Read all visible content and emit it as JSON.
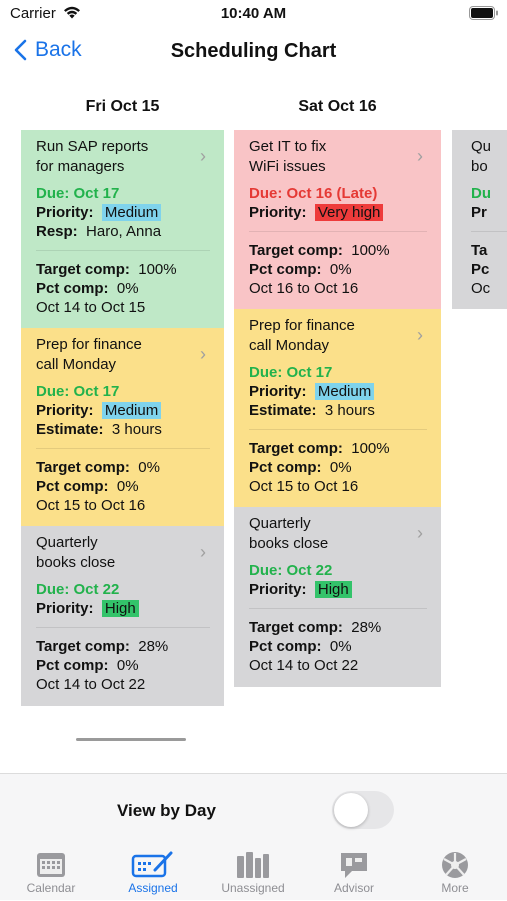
{
  "status": {
    "carrier": "Carrier",
    "time": "10:40 AM"
  },
  "nav": {
    "back_label": "Back",
    "title": "Scheduling Chart"
  },
  "days": [
    "Fri Oct 15",
    "Sat Oct 16"
  ],
  "cards": {
    "c1": {
      "title1": "Run SAP reports",
      "title2": "for managers",
      "due": "Due: Oct 17",
      "priority_label": "Priority:",
      "priority": "Medium",
      "extra_label": "Resp:",
      "extra": "Haro, Anna",
      "target_label": "Target comp:",
      "target": "100%",
      "pct_label": "Pct comp:",
      "pct": "0%",
      "range": "Oct 14 to Oct 15"
    },
    "c2": {
      "title1": "Prep for finance",
      "title2": "call Monday",
      "due": "Due: Oct 17",
      "priority_label": "Priority:",
      "priority": "Medium",
      "extra_label": "Estimate:",
      "extra": "3 hours",
      "target_label": "Target comp:",
      "target": "0%",
      "pct_label": "Pct comp:",
      "pct": "0%",
      "range": "Oct 15 to Oct 16"
    },
    "c3": {
      "title1": "Quarterly",
      "title2": "books close",
      "due": "Due: Oct 22",
      "priority_label": "Priority:",
      "priority": "High",
      "target_label": "Target comp:",
      "target": "28%",
      "pct_label": "Pct comp:",
      "pct": "0%",
      "range": "Oct 14 to Oct 22"
    },
    "c4": {
      "title1": "Get IT to fix",
      "title2": "WiFi issues",
      "due": "Due: Oct 16 (Late)",
      "priority_label": "Priority:",
      "priority": "Very high",
      "target_label": "Target comp:",
      "target": "100%",
      "pct_label": "Pct comp:",
      "pct": "0%",
      "range": "Oct 16 to Oct 16"
    },
    "c5": {
      "title1": "Prep for finance",
      "title2": "call Monday",
      "due": "Due: Oct 17",
      "priority_label": "Priority:",
      "priority": "Medium",
      "extra_label": "Estimate:",
      "extra": "3 hours",
      "target_label": "Target comp:",
      "target": "100%",
      "pct_label": "Pct comp:",
      "pct": "0%",
      "range": "Oct 15 to Oct 16"
    },
    "c6": {
      "title1": "Quarterly",
      "title2": "books close",
      "due": "Due: Oct 22",
      "priority_label": "Priority:",
      "priority": "High",
      "target_label": "Target comp:",
      "target": "28%",
      "pct_label": "Pct comp:",
      "pct": "0%",
      "range": "Oct 14 to Oct 22"
    },
    "c7": {
      "t1": "Qu",
      "t2": "bo",
      "due": "Du",
      "pr": "Pr",
      "ta": "Ta",
      "pc": "Pc",
      "oc": "Oc"
    }
  },
  "priority_colors": {
    "Medium": "#7fd3ec",
    "Very high": "#ee3b3b",
    "High": "#33c36a"
  },
  "bottom": {
    "view_by_day": "View by Day",
    "toggle_on": false
  },
  "tabs": [
    {
      "label": "Calendar",
      "icon": "calendar-icon"
    },
    {
      "label": "Assigned",
      "icon": "assigned-icon"
    },
    {
      "label": "Unassigned",
      "icon": "unassigned-icon"
    },
    {
      "label": "Advisor",
      "icon": "advisor-icon"
    },
    {
      "label": "More",
      "icon": "more-icon"
    }
  ]
}
